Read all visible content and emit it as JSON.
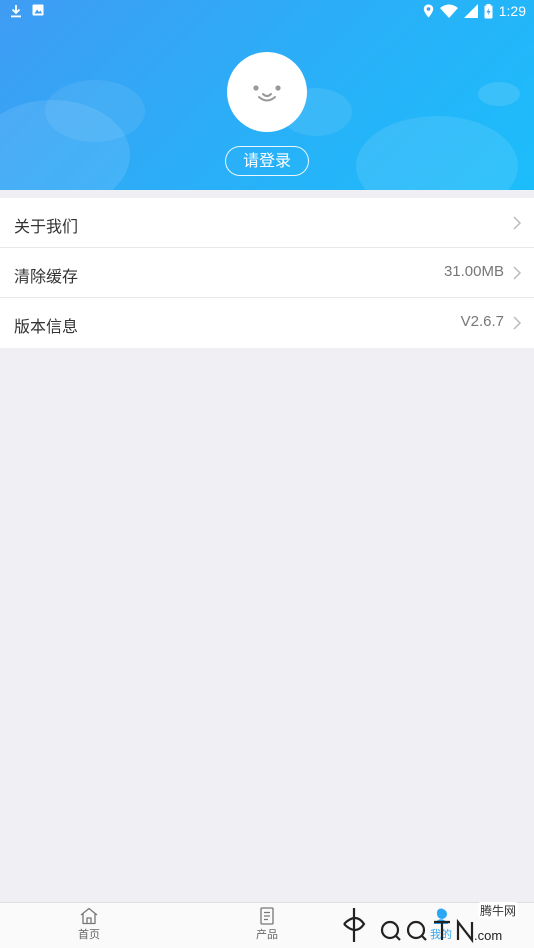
{
  "status_bar": {
    "time": "1:29",
    "left_icons": [
      "download-icon",
      "image-icon"
    ],
    "right_icons": [
      "location-icon",
      "wifi-icon",
      "signal-icon",
      "battery-icon"
    ]
  },
  "profile": {
    "login_label": "请登录"
  },
  "menu": {
    "items": [
      {
        "label": "关于我们",
        "value": ""
      },
      {
        "label": "清除缓存",
        "value": "31.00MB"
      },
      {
        "label": "版本信息",
        "value": "V2.6.7"
      }
    ]
  },
  "tabbar": {
    "tabs": [
      {
        "label": "首页",
        "icon": "home-icon"
      },
      {
        "label": "产品",
        "icon": "document-icon"
      },
      {
        "label": "我的",
        "icon": "user-icon"
      }
    ]
  },
  "watermark": {
    "text": "腾牛网",
    "logo": "qqtn.com"
  },
  "colors": {
    "header_start": "#3f9cf3",
    "header_end": "#1cbdfb",
    "accent": "#2aa7f5",
    "background": "#efeff4"
  }
}
